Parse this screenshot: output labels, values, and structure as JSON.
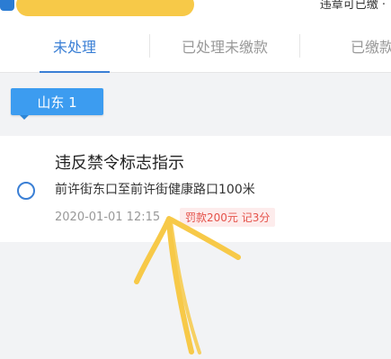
{
  "header": {
    "right_text": "违章可已缴 ·"
  },
  "tabs": [
    {
      "label": "未处理",
      "active": true
    },
    {
      "label": "已处理未缴款",
      "active": false
    },
    {
      "label": "已缴款",
      "active": false
    }
  ],
  "region_chip": {
    "label": "山东 1"
  },
  "violation": {
    "title": "违反禁令标志指示",
    "location": "前许街东口至前许街健康路口100米",
    "datetime": "2020-01-01 12:15",
    "penalty": "罚款200元 记3分"
  },
  "colors": {
    "accent": "#3a7fd5",
    "chip": "#3c9cf0",
    "penalty_text": "#e5524a",
    "penalty_bg": "#fdecec",
    "annotation": "#f7c948"
  }
}
